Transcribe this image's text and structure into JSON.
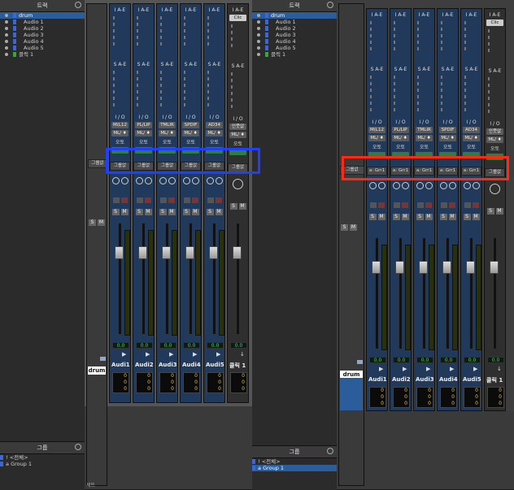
{
  "left": {
    "tracks_title": "트랙",
    "tracks": [
      {
        "label": "drum",
        "selected": true,
        "folder": true
      },
      {
        "label": "Audio 1"
      },
      {
        "label": "Audio 2"
      },
      {
        "label": "Audio 3"
      },
      {
        "label": "Audio 4"
      },
      {
        "label": "Audio 5"
      },
      {
        "label": "클릭 1",
        "green": true
      }
    ],
    "groups_title": "그룹",
    "groups": [
      {
        "flag": "!",
        "label": "<전체>"
      },
      {
        "flag": "a",
        "label": "Group 1"
      }
    ],
    "strips": [
      {
        "ins": "I A-E",
        "sends": "S A-E",
        "io_title": "I / O",
        "in": "M(L12",
        "out": "ML/ ♦",
        "auto": "오토",
        "grp": "그룹없",
        "name": "Audi1",
        "vol": "0.0"
      },
      {
        "ins": "I A-E",
        "sends": "S A-E",
        "io_title": "I / O",
        "in": "PL/LIP",
        "out": "ML/ ♦",
        "auto": "오토",
        "grp": "그룹없",
        "name": "Audi2",
        "vol": "0.0"
      },
      {
        "ins": "I A-E",
        "sends": "S A-E",
        "io_title": "I / O",
        "in": "TMLIR",
        "out": "ML/ ♦",
        "auto": "오토",
        "grp": "그룹없",
        "name": "Audi3",
        "vol": "0.0"
      },
      {
        "ins": "I A-E",
        "sends": "S A-E",
        "io_title": "I / O",
        "in": "SPDIF",
        "out": "ML/ ♦",
        "auto": "오토",
        "grp": "그룹없",
        "name": "Audi4",
        "vol": "0.0"
      },
      {
        "ins": "I A-E",
        "sends": "S A-E",
        "io_title": "I / O",
        "in": "AD34",
        "out": "ML/ ♦",
        "auto": "오토",
        "grp": "그룹없",
        "name": "Audi5",
        "vol": "0.0"
      },
      {
        "ins": "I A-E",
        "sends": "S A-E",
        "io_title": "I / O",
        "in": "인풋없",
        "out": "ML/ ♦",
        "auto": "오토",
        "grp": "그룹없",
        "name": "클릭 1",
        "vol": "0.0",
        "click": "Clic"
      }
    ],
    "folder_name": "drum",
    "folder_grp": "그룹없",
    "bottom_label": "세트"
  },
  "right": {
    "tracks_title": "트랙",
    "groups_title": "그룹",
    "groups": [
      {
        "flag": "!",
        "label": "<전체>"
      },
      {
        "flag": "a",
        "label": "Group 1"
      }
    ],
    "strips": [
      {
        "ins": "I A-E",
        "sends": "S A-E",
        "io_title": "I / O",
        "in": "M(L12",
        "out": "ML/ ♦",
        "auto": "오토",
        "grp": "a: Grr1",
        "name": "Audi1",
        "vol": "0.0"
      },
      {
        "ins": "I A-E",
        "sends": "S A-E",
        "io_title": "I / O",
        "in": "PL/LIP",
        "out": "ML/ ♦",
        "auto": "오토",
        "grp": "a: Grr1",
        "name": "Audi2",
        "vol": "0.0"
      },
      {
        "ins": "I A-E",
        "sends": "S A-E",
        "io_title": "I / O",
        "in": "TMLIR",
        "out": "ML/ ♦",
        "auto": "오토",
        "grp": "a: Grr1",
        "name": "Audi3",
        "vol": "0.0"
      },
      {
        "ins": "I A-E",
        "sends": "S A-E",
        "io_title": "I / O",
        "in": "SPDIF",
        "out": "ML/ ♦",
        "auto": "오토",
        "grp": "a: Grr1",
        "name": "Audi4",
        "vol": "0.0"
      },
      {
        "ins": "I A-E",
        "sends": "S A-E",
        "io_title": "I / O",
        "in": "AD34",
        "out": "ML/ ♦",
        "auto": "오토",
        "grp": "a: Grr1",
        "name": "Audi5",
        "vol": "0.0"
      },
      {
        "ins": "I A-E",
        "sends": "S A-E",
        "io_title": "I / O",
        "in": "인풋없",
        "out": "ML/ ♦",
        "auto": "오토",
        "grp": "그룹없",
        "name": "클릭 1",
        "vol": "0.0",
        "click": "Clic"
      }
    ],
    "folder_name": "drum",
    "folder_grp": "그룹없"
  },
  "colors": {
    "highlight_left": "#1f3fff",
    "highlight_right": "#ff2a10",
    "selection": "#2a5d9a"
  }
}
